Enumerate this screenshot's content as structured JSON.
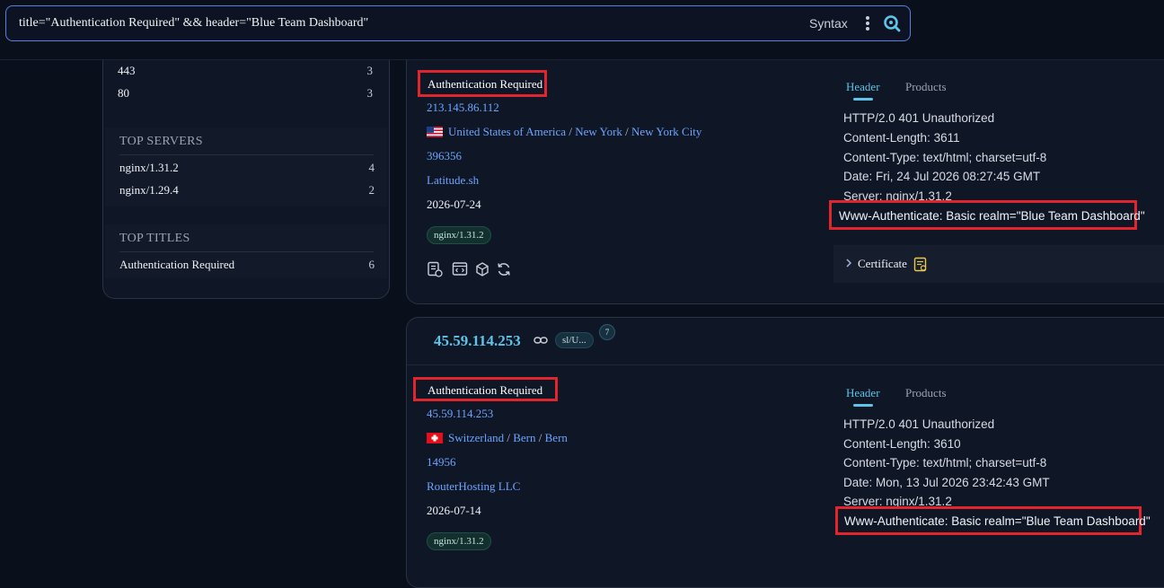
{
  "search": {
    "query": "title=\"Authentication Required\" && header=\"Blue Team Dashboard\"",
    "syntax_label": "Syntax"
  },
  "sidebar": {
    "ports": [
      {
        "label": "443",
        "count": "3"
      },
      {
        "label": "80",
        "count": "3"
      }
    ],
    "servers_heading": "TOP SERVERS",
    "servers": [
      {
        "label": "nginx/1.31.2",
        "count": "4"
      },
      {
        "label": "nginx/1.29.4",
        "count": "2"
      }
    ],
    "titles_heading": "TOP TITLES",
    "titles": [
      {
        "label": "Authentication Required",
        "count": "6"
      }
    ]
  },
  "results": [
    {
      "title": "Authentication Required",
      "ip": "213.145.86.112",
      "country": "United States of America",
      "region": "New York",
      "city": "New York City",
      "asn": "396356",
      "org": "Latitude.sh",
      "date": "2026-07-24",
      "server_tag": "nginx/1.31.2",
      "tabs": {
        "header": "Header",
        "products": "Products"
      },
      "headers": [
        "HTTP/2.0 401 Unauthorized",
        "Content-Length: 3611",
        "Content-Type: text/html; charset=utf-8",
        "Date: Fri, 24 Jul 2026 08:27:45 GMT",
        "Server: nginx/1.31.2"
      ],
      "www_authenticate": "Www-Authenticate: Basic realm=\"Blue Team Dashboard\"",
      "certificate_label": "Certificate"
    },
    {
      "host_title": "45.59.114.253",
      "host_tag": "sl/U...",
      "host_badge": "7",
      "title": "Authentication Required",
      "ip": "45.59.114.253",
      "country": "Switzerland",
      "region": "Bern",
      "city": "Bern",
      "asn": "14956",
      "org": "RouterHosting LLC",
      "date": "2026-07-14",
      "server_tag": "nginx/1.31.2",
      "tabs": {
        "header": "Header",
        "products": "Products"
      },
      "headers": [
        "HTTP/2.0 401 Unauthorized",
        "Content-Length: 3610",
        "Content-Type: text/html; charset=utf-8",
        "Date: Mon, 13 Jul 2026 23:42:43 GMT",
        "Server: nginx/1.31.2"
      ],
      "www_authenticate": "Www-Authenticate: Basic realm=\"Blue Team Dashboard\""
    }
  ],
  "colors": {
    "accent": "#5ec4e9",
    "link": "#6ea5ff",
    "highlight": "#e0262c"
  }
}
